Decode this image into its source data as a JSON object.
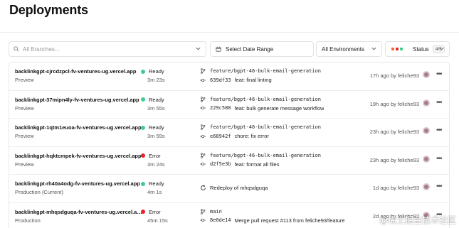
{
  "page": {
    "title": "Deployments"
  },
  "filters": {
    "branch_placeholder": "All Branches...",
    "date_label": "Select Date Range",
    "environment_label": "All Environments",
    "status_label": "Status",
    "status_count": "4/5"
  },
  "colors": {
    "ready": "#3ecf8e",
    "error": "#e5242a",
    "status_dot_1": "#f36b2a",
    "status_dot_2": "#e5242a",
    "status_dot_3": "#3ecf8e"
  },
  "deployments": [
    {
      "name": "backlinkgpt-cjrcdzpcl-fv-ventures-ug.vercel.app",
      "environment": "Preview",
      "status": "Ready",
      "duration": "3m 23s",
      "branch": "feature/bgpt-46-bulk-email-generation",
      "commit_hash": "639df33",
      "commit_message": "feat: final linting",
      "time": "17h ago",
      "author": "feliche93"
    },
    {
      "name": "backlinkgpt-37mipn4ly-fv-ventures-ug.vercel.app",
      "environment": "Preview",
      "status": "Ready",
      "duration": "3m 55s",
      "branch": "feature/bgpt-46-bulk-email-generation",
      "commit_hash": "229c588",
      "commit_message": "feat: bulk generate message workflow",
      "time": "19h ago",
      "author": "feliche93"
    },
    {
      "name": "backlinkgpt-1qtm1euoa-fv-ventures-ug.vercel.app",
      "environment": "Preview",
      "status": "Ready",
      "duration": "3m 59s",
      "branch": "feature/bgpt-46-bulk-email-generation",
      "commit_hash": "e68942f",
      "commit_message": "chore: fix error",
      "time": "23h ago",
      "author": "feliche93"
    },
    {
      "name": "backlinkgpt-hqktcmpek-fv-ventures-ug.vercel.app",
      "environment": "Preview",
      "status": "Error",
      "duration": "3m 24s",
      "branch": "feature/bgpt-46-bulk-email-generation",
      "commit_hash": "d2f5e3b",
      "commit_message": "feat: format all files",
      "time": "23h ago",
      "author": "feliche93"
    },
    {
      "name": "backlinkgpt-rh40a4odg-fv-ventures-ug.vercel.app",
      "environment": "Production (Current)",
      "status": "Ready",
      "duration": "4m 1s",
      "redeploy": "Redeploy of mhqsdguqa",
      "time": "1d ago",
      "author": "feliche93"
    },
    {
      "name": "backlinkgpt-mhqsdguqa-fv-ventures-ug.vercel.app",
      "environment": "Production",
      "status": "Error",
      "duration": "45m 15s",
      "branch": "main",
      "commit_hash": "8e0de14",
      "commit_message": "Merge pull request #113 from feliche93/feature",
      "time": "2d ago",
      "author": "feliche93"
    }
  ],
  "watermark": "@稀土掘金技术社区"
}
